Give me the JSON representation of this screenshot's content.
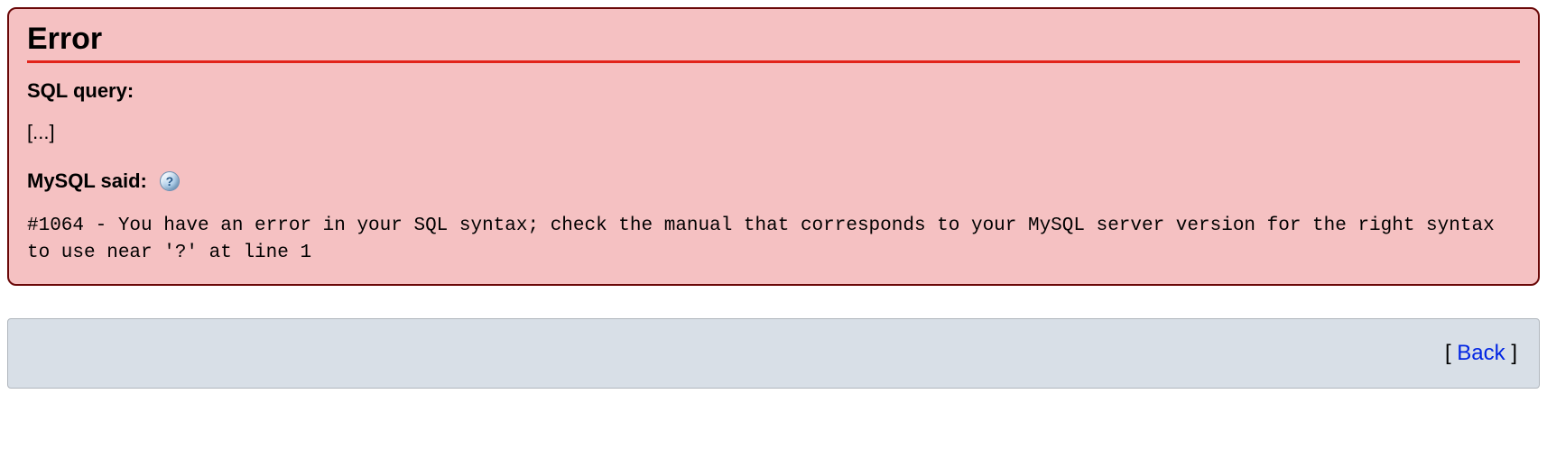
{
  "error": {
    "title": "Error",
    "sql_query_label": "SQL query:",
    "sql_query_text": "[...]",
    "mysql_said_label": "MySQL said:",
    "message": "#1064 - You have an error in your SQL syntax; check the manual that corresponds to your MySQL server version for the right syntax to use near '?' at line 1"
  },
  "footer": {
    "bracket_open": "[ ",
    "back_label": "Back",
    "bracket_close": " ]"
  }
}
